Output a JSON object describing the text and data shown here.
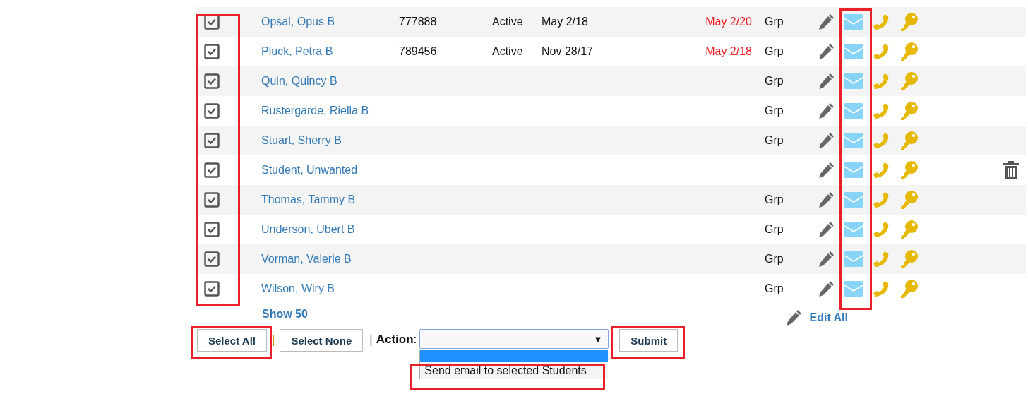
{
  "rows": [
    {
      "name": "Opsal, Opus B",
      "id": "777888",
      "status": "Active",
      "start": "May 2/18",
      "expiry": "May 2/20",
      "group": "Grp",
      "checked": true,
      "deletable": false
    },
    {
      "name": "Pluck, Petra B",
      "id": "789456",
      "status": "Active",
      "start": "Nov 28/17",
      "expiry": "May 2/18",
      "group": "Grp",
      "checked": true,
      "deletable": false
    },
    {
      "name": "Quin, Quincy B",
      "group": "Grp",
      "checked": true,
      "deletable": false
    },
    {
      "name": "Rustergarde, Riella B",
      "group": "Grp",
      "checked": true,
      "deletable": false
    },
    {
      "name": "Stuart, Sherry B",
      "group": "Grp",
      "checked": true,
      "deletable": false
    },
    {
      "name": "Student, Unwanted",
      "checked": true,
      "deletable": true
    },
    {
      "name": "Thomas, Tammy B",
      "group": "Grp",
      "checked": true,
      "deletable": false
    },
    {
      "name": "Underson, Ubert B",
      "group": "Grp",
      "checked": true,
      "deletable": false
    },
    {
      "name": "Vorman, Valerie B",
      "group": "Grp",
      "checked": true,
      "deletable": false
    },
    {
      "name": "Wilson, Wiry B",
      "group": "Grp",
      "checked": true,
      "deletable": false
    }
  ],
  "show_more": "Show 50",
  "edit_all": "Edit All",
  "buttons": {
    "select_all": "Select All",
    "select_none": "Select None",
    "submit": "Submit"
  },
  "separators": [
    "|",
    "|"
  ],
  "action": {
    "label": "Action",
    "colon": ":",
    "arrow": "▼",
    "options": [
      {
        "selected": true
      },
      {
        "label": "Send email to selected Students",
        "selected": false
      }
    ]
  }
}
